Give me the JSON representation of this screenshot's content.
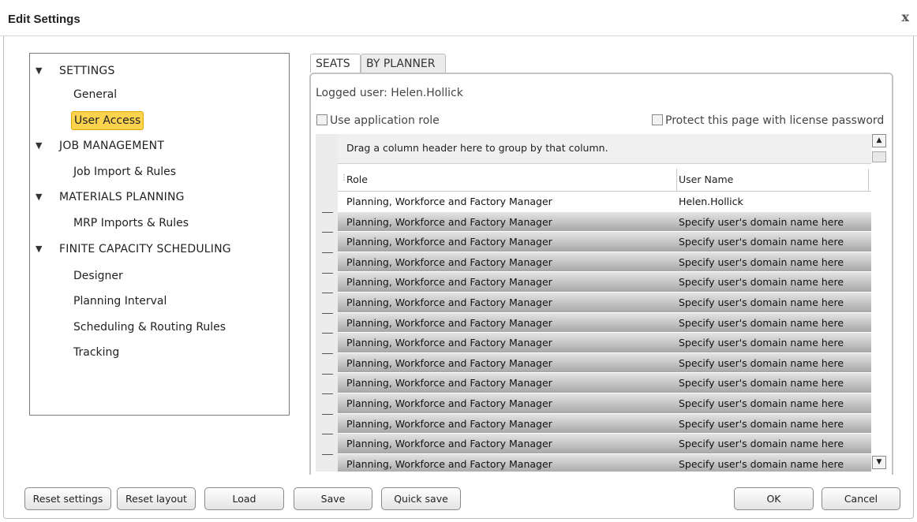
{
  "window": {
    "title": "Edit Settings",
    "close_glyph": "x"
  },
  "tree": {
    "categories": [
      {
        "label": "SETTINGS",
        "children": [
          "General",
          "User Access"
        ]
      },
      {
        "label": "JOB MANAGEMENT",
        "children": [
          "Job Import & Rules"
        ]
      },
      {
        "label": "MATERIALS PLANNING",
        "children": [
          "MRP Imports & Rules"
        ]
      },
      {
        "label": "FINITE CAPACITY SCHEDULING",
        "children": [
          "Designer",
          "Planning Interval",
          "Scheduling & Routing Rules",
          "Tracking"
        ]
      }
    ],
    "selected": "User Access"
  },
  "tabs": [
    {
      "label": "SEATS",
      "active": true
    },
    {
      "label": "BY PLANNER",
      "active": false
    }
  ],
  "logged_user": "Logged user: Helen.Hollick",
  "options": {
    "use_role": {
      "label": "Use application role",
      "checked": false
    },
    "protect": {
      "label": "Protect this page with license password",
      "checked": false
    }
  },
  "grid": {
    "group_hint": "Drag a column header here to group by that column.",
    "columns": [
      "Role",
      "User Name"
    ],
    "rows": [
      [
        "Planning, Workforce and Factory Manager",
        "Helen.Hollick"
      ],
      [
        "Planning, Workforce and Factory Manager",
        "Specify user's domain name here"
      ],
      [
        "Planning, Workforce and Factory Manager",
        "Specify user's domain name here"
      ],
      [
        "Planning, Workforce and Factory Manager",
        "Specify user's domain name here"
      ],
      [
        "Planning, Workforce and Factory Manager",
        "Specify user's domain name here"
      ],
      [
        "Planning, Workforce and Factory Manager",
        "Specify user's domain name here"
      ],
      [
        "Planning, Workforce and Factory Manager",
        "Specify user's domain name here"
      ],
      [
        "Planning, Workforce and Factory Manager",
        "Specify user's domain name here"
      ],
      [
        "Planning, Workforce and Factory Manager",
        "Specify user's domain name here"
      ],
      [
        "Planning, Workforce and Factory Manager",
        "Specify user's domain name here"
      ],
      [
        "Planning, Workforce and Factory Manager",
        "Specify user's domain name here"
      ],
      [
        "Planning, Workforce and Factory Manager",
        "Specify user's domain name here"
      ],
      [
        "Planning, Workforce and Factory Manager",
        "Specify user's domain name here"
      ],
      [
        "Planning, Workforce and Factory Manager",
        "Specify user's domain name here"
      ]
    ]
  },
  "buttons": {
    "reset_settings": "Reset settings",
    "reset_layout": "Reset layout",
    "load": "Load",
    "save": "Save",
    "quick_save": "Quick save",
    "ok": "OK",
    "cancel": "Cancel"
  },
  "colors": {
    "selected_highlight": "#fcd34d",
    "row_band": "#a7a7a7"
  }
}
